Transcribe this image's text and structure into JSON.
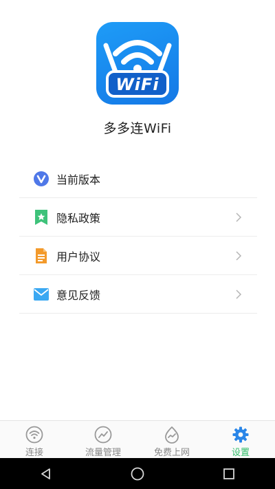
{
  "app": {
    "name": "多多连WiFi",
    "logo_text": "WiFi"
  },
  "menu": {
    "items": [
      {
        "label": "当前版本",
        "icon": "version-icon",
        "has_arrow": false
      },
      {
        "label": "隐私政策",
        "icon": "privacy-icon",
        "has_arrow": true
      },
      {
        "label": "用户协议",
        "icon": "agreement-icon",
        "has_arrow": true
      },
      {
        "label": "意见反馈",
        "icon": "feedback-icon",
        "has_arrow": true
      }
    ]
  },
  "tabbar": {
    "tabs": [
      {
        "label": "连接",
        "icon": "wifi-icon",
        "active": false
      },
      {
        "label": "流量管理",
        "icon": "traffic-icon",
        "active": false
      },
      {
        "label": "免费上网",
        "icon": "free-internet-icon",
        "active": false
      },
      {
        "label": "设置",
        "icon": "settings-gear-icon",
        "active": true
      }
    ]
  },
  "colors": {
    "logo_blue": "#1e9cf7",
    "active_tab": "#33bd6a",
    "inactive_tab": "#888888"
  },
  "system_nav": {
    "buttons": [
      "back-icon",
      "home-icon",
      "recents-icon"
    ]
  }
}
